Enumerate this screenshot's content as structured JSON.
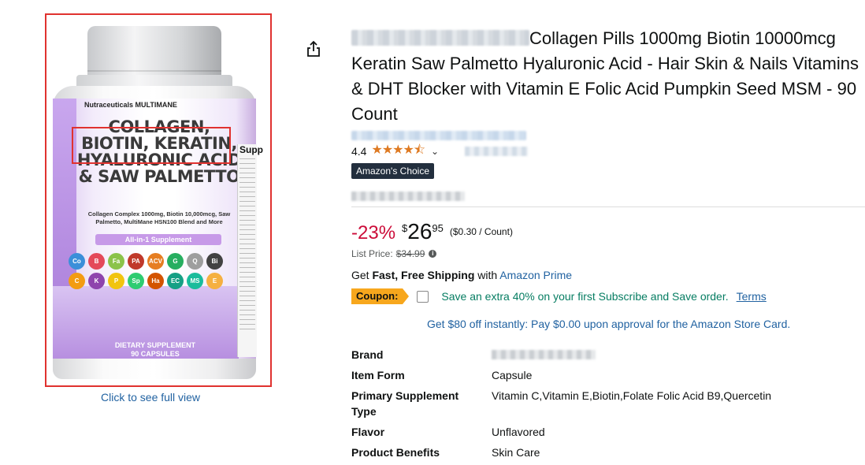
{
  "image": {
    "click_full_view": "Click to see full view",
    "bottle": {
      "brand": "Nutraceuticals MULTIMANE",
      "headline": [
        "COLLAGEN,",
        "BIOTIN, KERATIN,",
        "HYALURONIC ACID",
        "& SAW PALMETTO"
      ],
      "sub": "Collagen Complex 1000mg, Biotin 10,000mcg, Saw Palmetto, MultiMane HSN100 Blend and More",
      "all_in_1": "All-in-1 Supplement",
      "badges": [
        {
          "t": "Co",
          "c": "#3b8fd9"
        },
        {
          "t": "B",
          "c": "#e4495a"
        },
        {
          "t": "Fa",
          "c": "#8bc34a"
        },
        {
          "t": "PA",
          "c": "#c0392b"
        },
        {
          "t": "ACV",
          "c": "#e67e22"
        },
        {
          "t": "G",
          "c": "#27ae60"
        },
        {
          "t": "Q",
          "c": "#9e9e9e"
        },
        {
          "t": "Bi",
          "c": "#424242"
        },
        {
          "t": "C",
          "c": "#f39c12"
        },
        {
          "t": "K",
          "c": "#8e44ad"
        },
        {
          "t": "P",
          "c": "#f1c40f"
        },
        {
          "t": "Sp",
          "c": "#2ecc71"
        },
        {
          "t": "Ha",
          "c": "#d35400"
        },
        {
          "t": "EC",
          "c": "#16a085"
        },
        {
          "t": "MS",
          "c": "#1abc9c"
        },
        {
          "t": "E",
          "c": "#f5b041"
        }
      ],
      "dietary": "DIETARY SUPPLEMENT",
      "count": "90 CAPSULES",
      "side": "Supp"
    }
  },
  "share_icon": "share-icon",
  "product": {
    "title": "Collagen Pills 1000mg Biotin 10000mcg Keratin Saw Palmetto Hyaluronic Acid - Hair Skin & Nails Vitamins & DHT Blocker with Vitamin E Folic Acid Pumpkin Seed MSM - 90 Count",
    "rating": "4.4",
    "stars": "★★★★⯪",
    "badge": "Amazon's Choice",
    "discount": "-23%",
    "price_symbol": "$",
    "price_whole": "26",
    "price_fraction": "95",
    "unit_price": "($0.30 / Count)",
    "list_price_label": "List Price:",
    "list_price": "$34.99",
    "shipping_prefix": "Get ",
    "shipping_bold": "Fast, Free Shipping",
    "shipping_with": " with ",
    "shipping_link": "Amazon Prime",
    "coupon_label": "Coupon:",
    "coupon_text": "Save an extra 40% on your first Subscribe and Save order.",
    "coupon_terms": "Terms",
    "store_card": "Get $80 off instantly: Pay $0.00 upon approval for the Amazon Store Card."
  },
  "specs": [
    {
      "key": "Brand",
      "value": ""
    },
    {
      "key": "Item Form",
      "value": "Capsule"
    },
    {
      "key": "Primary Supplement Type",
      "value": "Vitamin C,Vitamin E,Biotin,Folate Folic Acid B9,Quercetin"
    },
    {
      "key": "Flavor",
      "value": "Unflavored"
    },
    {
      "key": "Product Benefits",
      "value": "Skin Care"
    }
  ],
  "colors": {
    "price_red": "#cc0c39",
    "link": "#2162a1",
    "star": "#de7921",
    "coupon": "#f7a71d",
    "green": "#067d62",
    "highlight": "#e0322f"
  }
}
